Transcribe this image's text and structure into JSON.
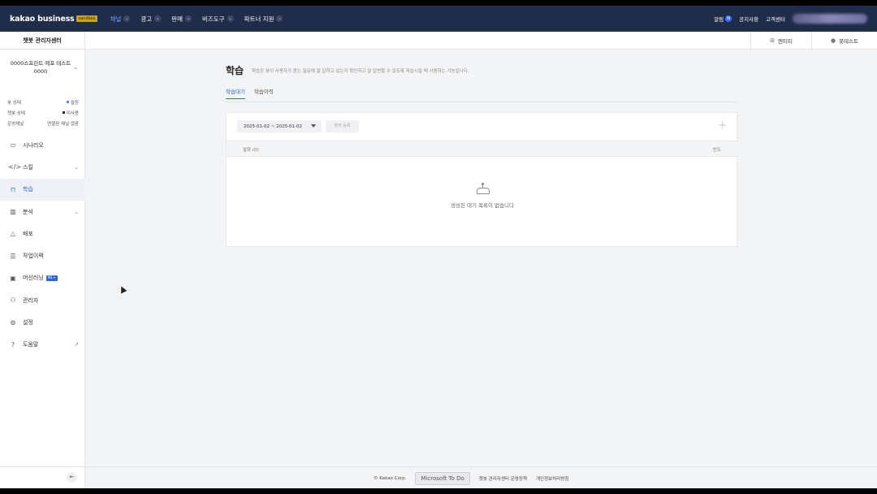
{
  "topnav": {
    "brand": "kakao business",
    "badge": "sandbox",
    "menu": [
      {
        "label": "채널",
        "active": true
      },
      {
        "label": "광고",
        "active": false
      },
      {
        "label": "판매",
        "active": false
      },
      {
        "label": "비즈도구",
        "active": false
      },
      {
        "label": "파트너 지원",
        "active": false
      }
    ],
    "alarm_label": "알림",
    "alarm_badge": "N",
    "notice": "공지사항",
    "support": "고객센터",
    "chevron": "⌄"
  },
  "subbar": {
    "title": "챗봇 관리자센터",
    "entity": "엔티티",
    "bot_test": "봇테스트"
  },
  "sidebar": {
    "bot_name": "0000스프린트 에포 테스트0000",
    "status": [
      {
        "label": "봇 상태",
        "value": "설정"
      },
      {
        "label": "챗봇 상태",
        "value": "미사용"
      },
      {
        "label": "운영채널",
        "value": "연결된 채널 없음"
      }
    ],
    "items": [
      {
        "label": "시나리오",
        "icon": "▭"
      },
      {
        "label": "스킬",
        "icon": "</>"
      },
      {
        "label": "학습",
        "icon": "⊓"
      },
      {
        "label": "분석",
        "icon": "▥"
      },
      {
        "label": "배포",
        "icon": "△"
      },
      {
        "label": "작업이력",
        "icon": "☰"
      },
      {
        "label": "머신러닝",
        "icon": "▣",
        "badge": "ML+"
      },
      {
        "label": "관리자",
        "icon": "⚇"
      },
      {
        "label": "설정",
        "icon": "⚙"
      },
      {
        "label": "도움말",
        "icon": "?"
      }
    ],
    "collapse": "←"
  },
  "main": {
    "title": "학습",
    "description": "학습은 봇이 사용자가 묻는 질문에 잘 답하고 있는지 확인하고 잘 답변할 수 있도록 학습시킬 때 사용하는 기능입니다.",
    "tabs": [
      {
        "label": "학습대기",
        "active": true
      },
      {
        "label": "학습이력",
        "active": false
      }
    ],
    "date_range": "2025-01-02 ~ 2025-01-02",
    "output_button": "출력 등록",
    "plus": "+",
    "columns": {
      "left": "발화 (0)",
      "right": "빈도"
    },
    "empty_message": "생성된 대기 목록이 없습니다"
  },
  "footer": {
    "copyright": "© Kakao Corp.",
    "ms_todo": "Microsoft To Do",
    "policy": "챗봇 관리자센터 운영정책",
    "privacy": "개인정보처리방침"
  }
}
